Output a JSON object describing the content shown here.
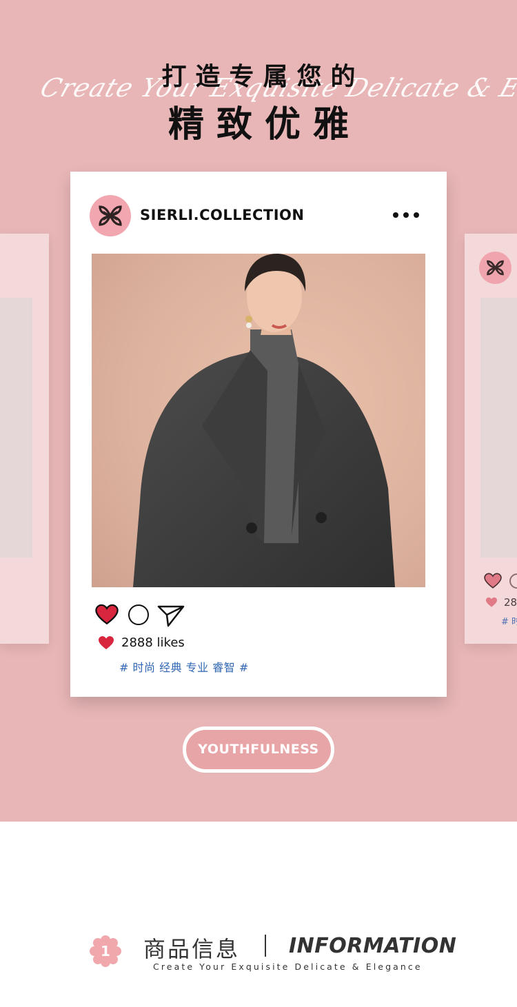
{
  "hero": {
    "background_color": "#e8b6b7",
    "title_line1": "打造专属您的",
    "title_line2": "精致优雅",
    "script_text": "Create Your Exquisite Delicate & Elegance"
  },
  "post": {
    "username": "SIERLI.COLLECTION",
    "likes": "2888 likes",
    "tags": "# 时尚 经典 专业 睿智 #",
    "heart_color": "#d9263f",
    "tag_color": "#2f66b3",
    "icons": [
      "logo-icon",
      "more-icon",
      "heart-icon",
      "comment-icon",
      "send-icon"
    ]
  },
  "side_post": {
    "likes": "28",
    "tags": "# 时"
  },
  "pill": {
    "label": "YOUTHFULNESS"
  },
  "info": {
    "number": "1",
    "title_cn": "商品信息",
    "title_en": "INFORMATION",
    "subtitle": "Create Your Exquisite Delicate & Elegance",
    "accent_color": "#f0a8ac"
  }
}
